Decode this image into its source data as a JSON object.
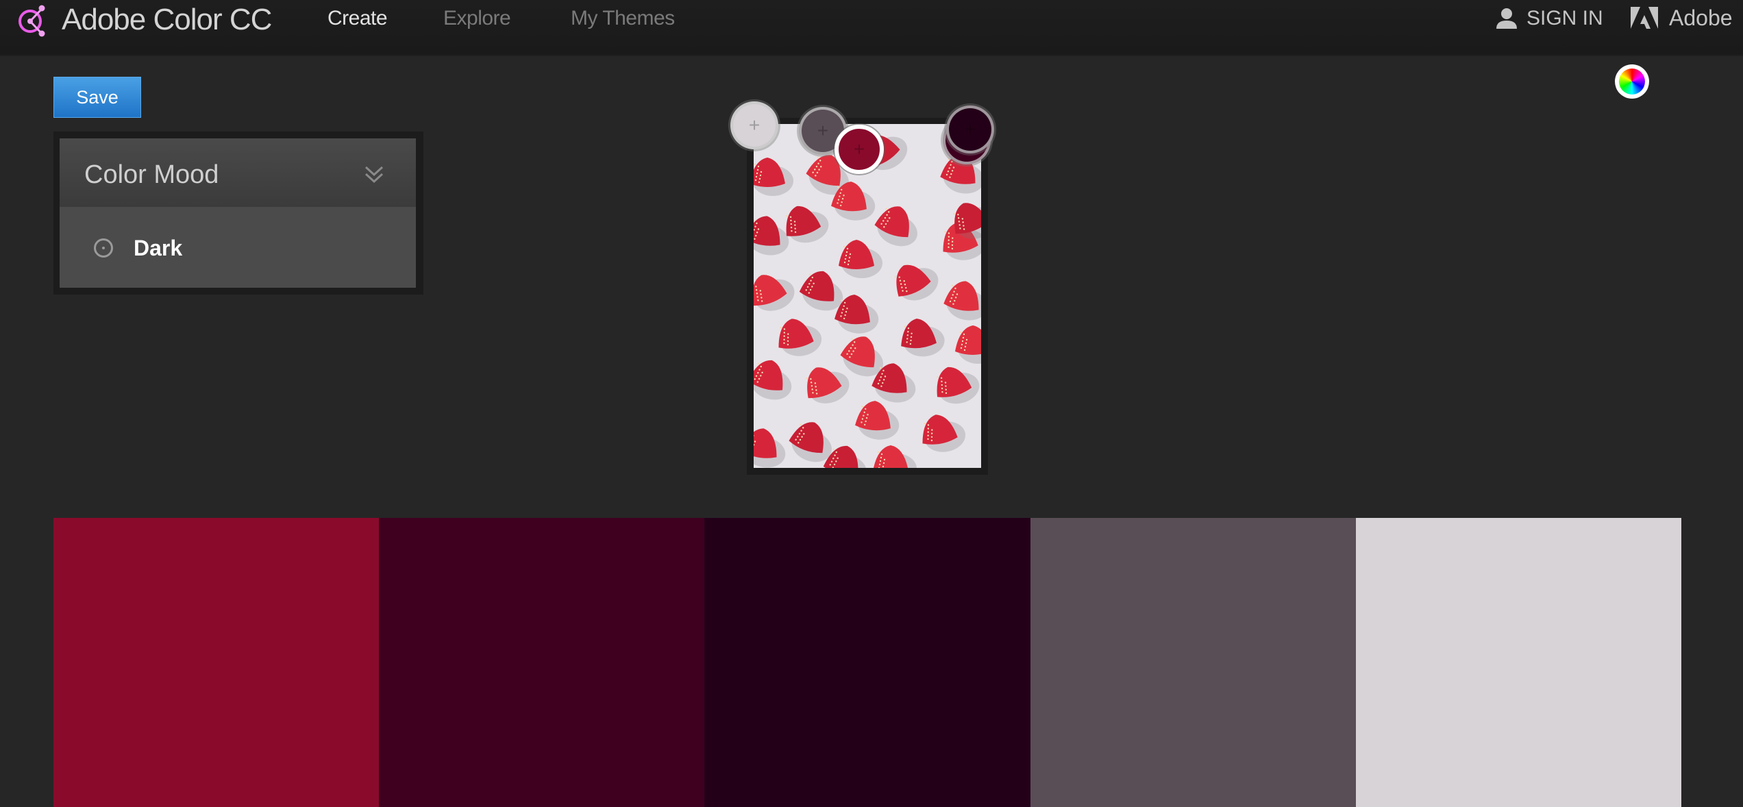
{
  "app": {
    "title": "Adobe Color CC",
    "brand_color": "#e85ce8"
  },
  "nav": {
    "items": [
      {
        "label": "Create",
        "active": true
      },
      {
        "label": "Explore",
        "active": false
      },
      {
        "label": "My Themes",
        "active": false
      }
    ]
  },
  "header_right": {
    "sign_in": "SIGN IN",
    "adobe": "Adobe"
  },
  "toolbar": {
    "save_label": "Save"
  },
  "color_rule_panel": {
    "title": "Color Mood",
    "selected_option": "Dark",
    "icon": "chevron-double-down-icon"
  },
  "color_wheel_button": {
    "icon": "color-wheel-icon"
  },
  "image": {
    "subject": "strawberries on white background"
  },
  "pickers": [
    {
      "color": "#d8d3d7",
      "active": false,
      "label": "+"
    },
    {
      "color": "#594d56",
      "active": false,
      "label": "+"
    },
    {
      "color": "#8a0a2c",
      "active": true,
      "label": "+"
    },
    {
      "color": "#3f0020",
      "active": false,
      "label": "+"
    },
    {
      "color": "#240018",
      "active": false,
      "label": "+"
    }
  ],
  "swatches": [
    {
      "color": "#8a0a2c"
    },
    {
      "color": "#3f0020"
    },
    {
      "color": "#240018"
    },
    {
      "color": "#594d56"
    },
    {
      "color": "#d8d3d7"
    }
  ]
}
